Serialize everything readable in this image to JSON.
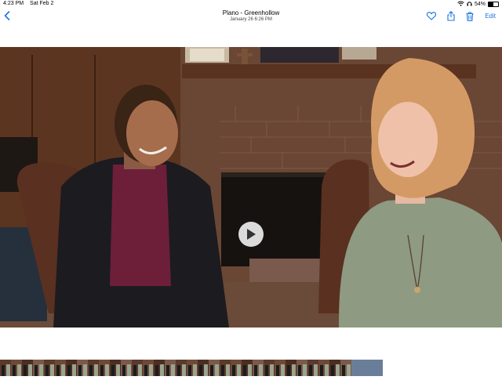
{
  "status": {
    "time": "4:23 PM",
    "date": "Sat Feb 2",
    "battery": "54%",
    "battery_level": 0.54
  },
  "nav": {
    "back_icon": "chevron-left-icon",
    "title": "Plano - Greenhollow",
    "subtitle": "January 26  6:26 PM",
    "edit_label": "Edit"
  },
  "icons": [
    "heart-icon",
    "share-icon",
    "trash-icon",
    "play-icon"
  ],
  "colors": {
    "accent": "#1a73e8"
  }
}
